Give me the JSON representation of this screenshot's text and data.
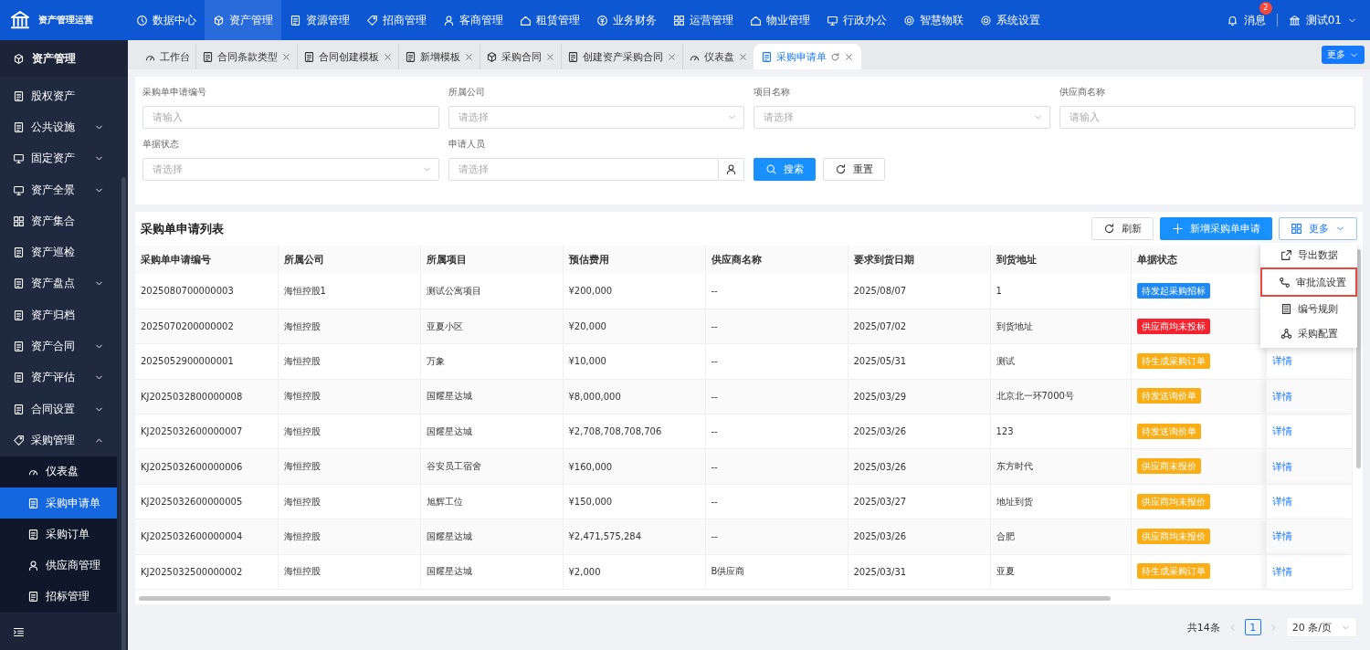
{
  "app": {
    "title": "资产管理运营"
  },
  "top_nav": [
    {
      "label": "数据中心",
      "selected": false
    },
    {
      "label": "资产管理",
      "selected": true
    },
    {
      "label": "资源管理",
      "selected": false
    },
    {
      "label": "招商管理",
      "selected": false
    },
    {
      "label": "客商管理",
      "selected": false
    },
    {
      "label": "租赁管理",
      "selected": false
    },
    {
      "label": "业务财务",
      "selected": false
    },
    {
      "label": "运营管理",
      "selected": false
    },
    {
      "label": "物业管理",
      "selected": false
    },
    {
      "label": "行政办公",
      "selected": false
    },
    {
      "label": "智慧物联",
      "selected": false
    },
    {
      "label": "系统设置",
      "selected": false
    }
  ],
  "user_area": {
    "messages": {
      "label": "消息",
      "badge": "2"
    },
    "user": "测试01"
  },
  "sidebar": {
    "title": "资产管理",
    "items": [
      {
        "label": "股权资产",
        "kind": "link",
        "selected": false
      },
      {
        "label": "公共设施",
        "kind": "group",
        "expanded": false
      },
      {
        "label": "固定资产",
        "kind": "group",
        "expanded": false
      },
      {
        "label": "资产全景",
        "kind": "group",
        "expanded": false
      },
      {
        "label": "资产集合",
        "kind": "link",
        "selected": false
      },
      {
        "label": "资产巡检",
        "kind": "link",
        "selected": false
      },
      {
        "label": "资产盘点",
        "kind": "group",
        "expanded": false
      },
      {
        "label": "资产归档",
        "kind": "link",
        "selected": false
      },
      {
        "label": "资产合同",
        "kind": "group",
        "expanded": false
      },
      {
        "label": "资产评估",
        "kind": "group",
        "expanded": false
      },
      {
        "label": "合同设置",
        "kind": "group",
        "expanded": false
      },
      {
        "label": "采购管理",
        "kind": "group",
        "expanded": true,
        "children": [
          {
            "label": "仪表盘",
            "selected": false
          },
          {
            "label": "采购申请单",
            "selected": true
          },
          {
            "label": "采购订单",
            "selected": false
          },
          {
            "label": "供应商管理",
            "selected": false
          },
          {
            "label": "招标管理",
            "selected": false
          }
        ]
      }
    ]
  },
  "tabs": [
    {
      "label": "工作台",
      "selected": false,
      "closable": false
    },
    {
      "label": "合同条款类型",
      "selected": false,
      "closable": true
    },
    {
      "label": "合同创建模板",
      "selected": false,
      "closable": true
    },
    {
      "label": "新增模板",
      "selected": false,
      "closable": true
    },
    {
      "label": "采购合同",
      "selected": false,
      "closable": true
    },
    {
      "label": "创建资产采购合同",
      "selected": false,
      "closable": true
    },
    {
      "label": "仪表盘",
      "selected": false,
      "closable": true
    },
    {
      "label": "采购申请单",
      "selected": true,
      "closable": true
    }
  ],
  "tabs_more": "更多",
  "filters": [
    {
      "label": "采购单申请编号",
      "kind": "input",
      "placeholder": "请输入"
    },
    {
      "label": "所属公司",
      "kind": "select",
      "placeholder": "请选择"
    },
    {
      "label": "项目名称",
      "kind": "select",
      "placeholder": "请选择"
    },
    {
      "label": "供应商名称",
      "kind": "input",
      "placeholder": "请输入"
    },
    {
      "label": "单据状态",
      "kind": "select",
      "placeholder": "请选择"
    },
    {
      "label": "申请人员",
      "kind": "person",
      "placeholder": "请选择"
    }
  ],
  "filter_buttons": [
    {
      "label": "搜索",
      "kind": "primary"
    },
    {
      "label": "重置",
      "kind": "reset"
    }
  ],
  "table": {
    "title": "采购单申请列表",
    "toolbar": [
      {
        "label": "刷新",
        "kind": "refresh"
      },
      {
        "label": "新增采购单申请",
        "kind": "add"
      },
      {
        "label": "更多",
        "kind": "more"
      }
    ],
    "more_menu": [
      {
        "label": "导出数据",
        "highlighted": false
      },
      {
        "label": "审批流设置",
        "highlighted": true
      },
      {
        "label": "编号规则",
        "highlighted": false
      },
      {
        "label": "采购配置",
        "highlighted": false
      }
    ],
    "columns": [
      "采购单申请编号",
      "所属公司",
      "所属项目",
      "预估费用",
      "供应商名称",
      "要求到货日期",
      "到货地址",
      "单据状态"
    ],
    "rows": [
      {
        "cells": [
          "2025080700000003",
          "海恒控股1",
          "测试公寓项目",
          "¥200,000",
          "--",
          "2025/08/07",
          "1"
        ],
        "status": {
          "label": "待发起采购招标",
          "color": "#1e88f5"
        }
      },
      {
        "cells": [
          "2025070200000002",
          "海恒控股",
          "亚夏小区",
          "¥20,000",
          "--",
          "2025/07/02",
          "到货地址"
        ],
        "status": {
          "label": "供应商均未投标",
          "color": "#f5222d"
        }
      },
      {
        "cells": [
          "2025052900000001",
          "海恒控股",
          "万象",
          "¥10,000",
          "--",
          "2025/05/31",
          "测试"
        ],
        "status": {
          "label": "待生成采购订单",
          "color": "#faad14"
        },
        "action": "详情"
      },
      {
        "cells": [
          "KJ2025032800000008",
          "海恒控股",
          "国耀星达城",
          "¥8,000,000",
          "--",
          "2025/03/29",
          "北京北一环7000号"
        ],
        "status": {
          "label": "待发送询价单",
          "color": "#faad14"
        },
        "action": "详情"
      },
      {
        "cells": [
          "KJ2025032600000007",
          "海恒控股",
          "国耀星达城",
          "¥2,708,708,708,706",
          "--",
          "2025/03/26",
          "123"
        ],
        "status": {
          "label": "待发送询价单",
          "color": "#faad14"
        },
        "action": "详情"
      },
      {
        "cells": [
          "KJ2025032600000006",
          "海恒控股",
          "谷安员工宿舍",
          "¥160,000",
          "--",
          "2025/03/26",
          "东方时代"
        ],
        "status": {
          "label": "供应商未报价",
          "color": "#faad14"
        },
        "action": "详情"
      },
      {
        "cells": [
          "KJ2025032600000005",
          "海恒控股",
          "旭辉工位",
          "¥150,000",
          "--",
          "2025/03/27",
          "地址到货"
        ],
        "status": {
          "label": "供应商均未报价",
          "color": "#faad14"
        },
        "action": "详情"
      },
      {
        "cells": [
          "KJ2025032600000004",
          "海恒控股",
          "国耀星达城",
          "¥2,471,575,284",
          "--",
          "2025/03/26",
          "合肥"
        ],
        "status": {
          "label": "供应商均未报价",
          "color": "#faad14"
        },
        "action": "详情"
      },
      {
        "cells": [
          "KJ2025032500000002",
          "海恒控股",
          "国耀星达城",
          "¥2,000",
          "B供应商",
          "2025/03/31",
          "亚夏"
        ],
        "status": {
          "label": "待生成采购订单",
          "color": "#faad14"
        },
        "action": "详情"
      }
    ]
  },
  "pagination": {
    "total": "共14条",
    "pages": [
      {
        "label": "1",
        "selected": true
      }
    ],
    "page_size": "20 条/页"
  }
}
